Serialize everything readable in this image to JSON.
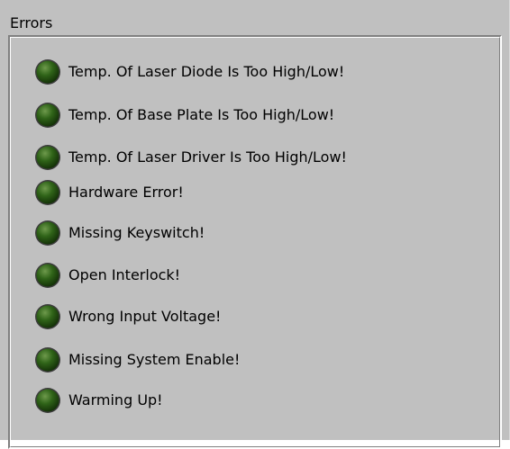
{
  "group": {
    "title": "Errors"
  },
  "led_colors": {
    "off_dark": "#102a05",
    "off_mid": "#2f6318",
    "off_light": "#6e9a4c",
    "shadow": "#3c3c3c",
    "highlight": "#ffffff"
  },
  "errors": [
    {
      "label": "Temp. Of Laser Diode Is Too High/Low!",
      "state": "off"
    },
    {
      "label": "Temp. Of Base Plate Is Too High/Low!",
      "state": "off"
    },
    {
      "label": "Temp. Of Laser Driver Is Too High/Low!",
      "state": "off"
    },
    {
      "label": "Hardware Error!",
      "state": "off"
    },
    {
      "label": "Missing Keyswitch!",
      "state": "off"
    },
    {
      "label": "Open Interlock!",
      "state": "off"
    },
    {
      "label": "Wrong Input Voltage!",
      "state": "off"
    },
    {
      "label": "Missing System Enable!",
      "state": "off"
    },
    {
      "label": "Warming Up!",
      "state": "off"
    }
  ]
}
